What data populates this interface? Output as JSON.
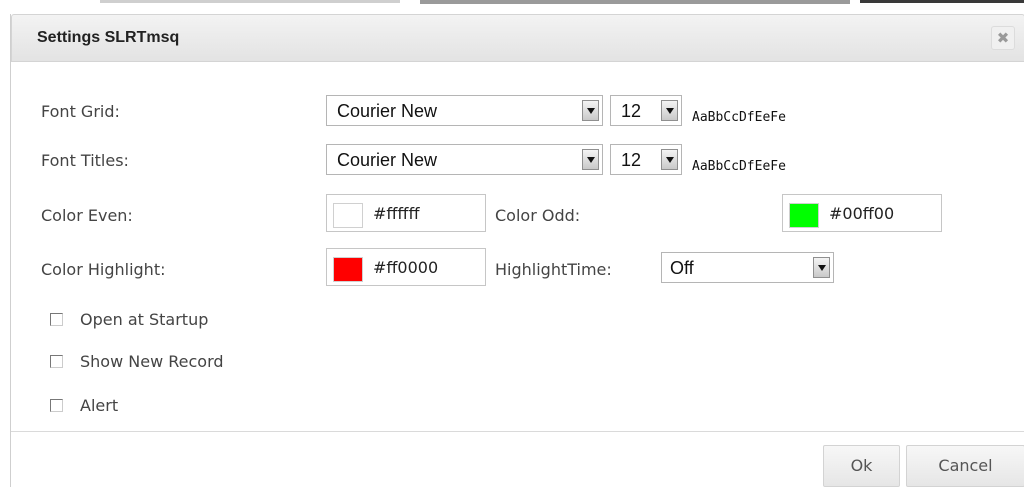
{
  "dialog": {
    "title": "Settings SLRTmsq",
    "close_glyph": "✖"
  },
  "fonts": {
    "grid_label": "Font Grid:",
    "grid_font": "Courier New",
    "grid_size": "12",
    "titles_label": "Font Titles:",
    "titles_font": "Courier New",
    "titles_size": "12",
    "sample_text": "AaBbCcDfEeFe"
  },
  "colors": {
    "even_label": "Color Even:",
    "even_value": "#ffffff",
    "odd_label": "Color Odd:",
    "odd_value": "#00ff00",
    "highlight_label": "Color Highlight:",
    "highlight_value": "#ff0000",
    "highlight_time_label": "HighlightTime:",
    "highlight_time_value": "Off"
  },
  "options": {
    "open_at_startup": "Open at Startup",
    "show_new_record": "Show New Record",
    "alert": "Alert"
  },
  "buttons": {
    "ok": "Ok",
    "cancel": "Cancel"
  }
}
